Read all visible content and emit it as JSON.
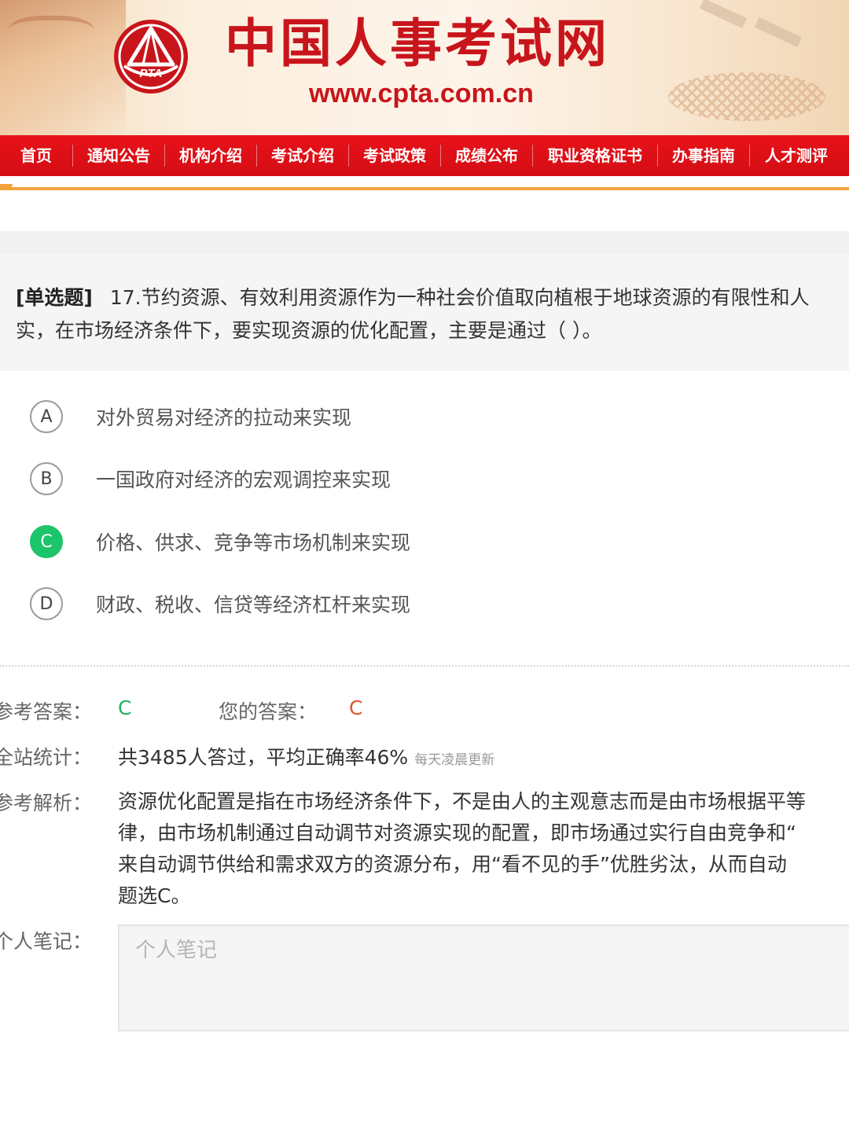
{
  "header": {
    "site_title": "中国人事考试网",
    "site_url": "www.cpta.com.cn",
    "logo_text": "PTA",
    "brand_color": "#c8151b"
  },
  "nav": {
    "items": [
      "首页",
      "通知公告",
      "机构介绍",
      "考试介绍",
      "考试政策",
      "成绩公布",
      "职业资格证书",
      "办事指南",
      "人才测评"
    ],
    "bg_color": "#d40d14",
    "accent_line_color": "#f2a33a"
  },
  "question": {
    "type_label": "[单选题]",
    "line1": "17.节约资源、有效利用资源作为一种社会价值取向植根于地球资源的有限性和人",
    "line2": "实，在市场经济条件下，要实现资源的优化配置，主要是通过（    ）。"
  },
  "options": [
    {
      "letter": "A",
      "text": "对外贸易对经济的拉动来实现",
      "selected": false
    },
    {
      "letter": "B",
      "text": "一国政府对经济的宏观调控来实现",
      "selected": false
    },
    {
      "letter": "C",
      "text": "价格、供求、竞争等市场机制来实现",
      "selected": true
    },
    {
      "letter": "D",
      "text": "财政、税收、信贷等经济杠杆来实现",
      "selected": false
    }
  ],
  "answer": {
    "ref_label": "参考答案：",
    "ref_value": "C",
    "mine_label": "您的答案：",
    "mine_value": "C",
    "stats_label": "全站统计：",
    "stats_value": "共3485人答过，平均正确率46%",
    "stats_note": "每天凌晨更新",
    "explain_label": "参考解析：",
    "explain_lines": [
      "资源优化配置是指在市场经济条件下，不是由人的主观意志而是由市场根据平等",
      "律，由市场机制通过自动调节对资源实现的配置，即市场通过实行自由竞争和“",
      "来自动调节供给和需求双方的资源分布，用“看不见的手”优胜劣汰，从而自动",
      "题选C。"
    ],
    "notes_label": "个人笔记：",
    "notes_placeholder": "个人笔记"
  }
}
